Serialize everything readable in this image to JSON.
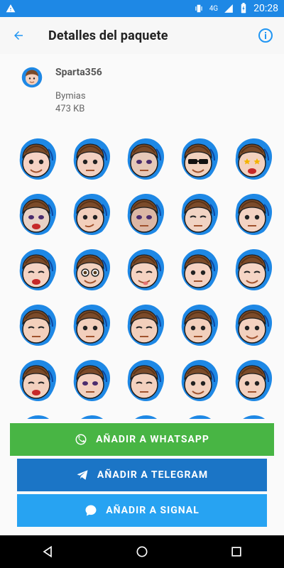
{
  "status_bar": {
    "time": "20:28",
    "network": "4G"
  },
  "app_bar": {
    "title": "Detalles del paquete"
  },
  "pack": {
    "name": "Sparta356",
    "author": "Bymias",
    "size": "473 KB"
  },
  "stickers": [
    {
      "face": "#f6d2c4",
      "eye": "normal",
      "mouth": "smile"
    },
    {
      "face": "#f3d0c0",
      "eye": "normal",
      "mouth": "flat"
    },
    {
      "face": "#e6c8b8",
      "eye": "dark",
      "mouth": "flat"
    },
    {
      "face": "#f1d1be",
      "eye": "sunglasses",
      "mouth": "smile"
    },
    {
      "face": "#f3d1bf",
      "eye": "star",
      "mouth": "open"
    },
    {
      "face": "#e8d1c5",
      "eye": "dark",
      "mouth": "open"
    },
    {
      "face": "#f2cfbc",
      "eye": "normal",
      "mouth": "smirk"
    },
    {
      "face": "#dcb7a5",
      "eye": "dark",
      "mouth": "flat"
    },
    {
      "face": "#f1d3c3",
      "eye": "closed",
      "mouth": "flat"
    },
    {
      "face": "#f4d3c3",
      "eye": "normal",
      "mouth": "flat"
    },
    {
      "face": "#f4d3c3",
      "eye": "closed",
      "mouth": "open"
    },
    {
      "face": "#f2d1bf",
      "eye": "big",
      "mouth": "smile"
    },
    {
      "face": "#f5d3c2",
      "eye": "closed",
      "mouth": "tongue"
    },
    {
      "face": "#f5d2c2",
      "eye": "normal",
      "mouth": "flat"
    },
    {
      "face": "#f5d5c5",
      "eye": "closed",
      "mouth": "smile"
    },
    {
      "face": "#f3d0bc",
      "eye": "closed",
      "mouth": "flat"
    },
    {
      "face": "#f2cfbc",
      "eye": "normal",
      "mouth": "flat"
    },
    {
      "face": "#f2cfbc",
      "eye": "closed",
      "mouth": "flat"
    },
    {
      "face": "#f2cfbc",
      "eye": "normal",
      "mouth": "flat"
    },
    {
      "face": "#f3d1bf",
      "eye": "normal",
      "mouth": "smile"
    },
    {
      "face": "#f3d1bf",
      "eye": "closed",
      "mouth": "open"
    },
    {
      "face": "#f3d1bf",
      "eye": "dark",
      "mouth": "flat"
    },
    {
      "face": "#f3d1bf",
      "eye": "closed",
      "mouth": "flat"
    },
    {
      "face": "#f3d1bf",
      "eye": "normal",
      "mouth": "smile"
    },
    {
      "face": "#f3d1bf",
      "eye": "normal",
      "mouth": "flat"
    },
    {
      "face": "#f3d1bf",
      "eye": "normal",
      "mouth": "flat"
    },
    {
      "face": "#f3d1bf",
      "eye": "normal",
      "mouth": "flat"
    },
    {
      "face": "#f3d1bf",
      "eye": "normal",
      "mouth": "flat"
    },
    {
      "face": "#f3d1bf",
      "eye": "normal",
      "mouth": "flat"
    },
    {
      "face": "#f3d1bf",
      "eye": "normal",
      "mouth": "flat"
    }
  ],
  "buttons": {
    "whatsapp": "AÑADIR A WHATSAPP",
    "telegram": "AÑADIR A TELEGRAM",
    "signal": "AÑADIR A SIGNAL"
  },
  "colors": {
    "status_bar": "#1e88e5",
    "accent": "#2196f3",
    "whatsapp": "#48b544",
    "telegram": "#1b75c6",
    "signal": "#27a3f2"
  }
}
